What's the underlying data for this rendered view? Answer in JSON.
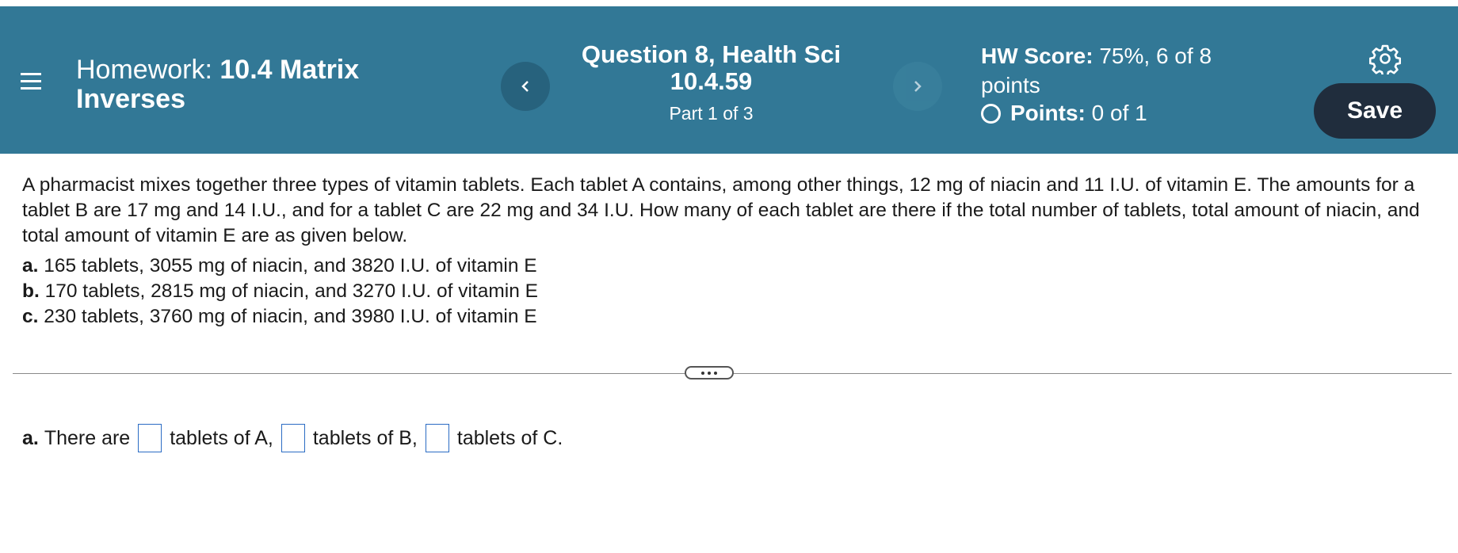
{
  "header": {
    "homework_label": "Homework:",
    "homework_name_line1": "10.4 Matrix",
    "homework_name_line2": "Inverses",
    "question_title_line1": "Question 8, Health Sci",
    "question_title_line2": "10.4.59",
    "part_label": "Part 1 of 3",
    "hw_score_label": "HW Score:",
    "hw_score_value": "75%, 6 of 8",
    "hw_score_unit": "points",
    "points_label": "Points:",
    "points_value": "0 of 1",
    "save_label": "Save",
    "prev_icon": "chevron-left-icon",
    "next_icon": "chevron-right-icon",
    "settings_icon": "gear-icon",
    "colors": {
      "header_bg": "#327896",
      "save_bg": "#202d3d"
    }
  },
  "question": {
    "text": "A pharmacist mixes together three types of vitamin tablets. Each tablet A contains, among other things, 12 mg of niacin and 11 I.U. of vitamin E. The amounts for a tablet B are 17 mg and 14 I.U., and for a tablet C are 22 mg and 34 I.U. How many of each tablet are there if the total number of tablets, total amount of niacin, and total amount of vitamin E are as given below.",
    "items": [
      {
        "label": "a.",
        "text": " 165 tablets, 3055 mg of niacin, and 3820 I.U. of vitamin E"
      },
      {
        "label": "b.",
        "text": " 170 tablets, 2815 mg of niacin, and 3270 I.U. of vitamin E"
      },
      {
        "label": "c.",
        "text": " 230 tablets, 3760 mg of niacin, and 3980 I.U. of vitamin E"
      }
    ]
  },
  "answer": {
    "label": "a.",
    "prefix": "There are",
    "after_a": "tablets of A,",
    "after_b": "tablets of B,",
    "after_c": "tablets of C."
  }
}
